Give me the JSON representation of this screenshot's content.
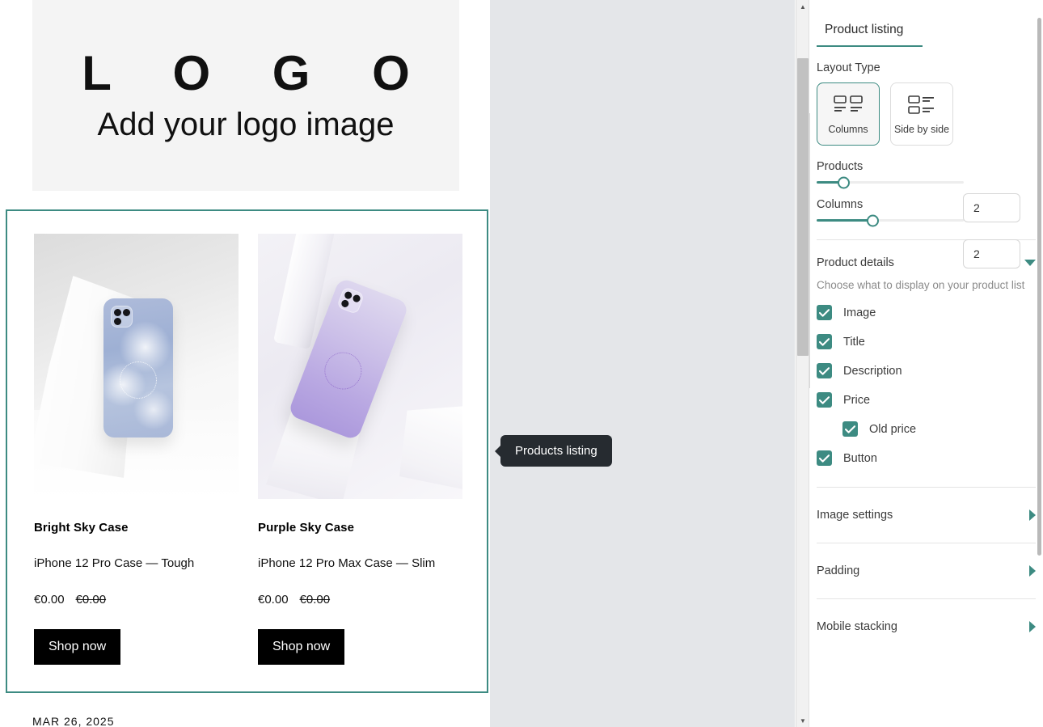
{
  "canvas": {
    "logo": {
      "word": "L O G O",
      "subtitle": "Add your logo image"
    },
    "selected_block_tooltip": "Products listing",
    "post_date": "MAR 26, 2025",
    "products": [
      {
        "title": "Bright Sky Case",
        "description": "iPhone 12 Pro Case — Tough",
        "price": "€0.00",
        "old_price": "€0.00",
        "button_label": "Shop now",
        "image_alt": "blue-cloud-phone-case"
      },
      {
        "title": "Purple Sky Case",
        "description": "iPhone 12 Pro Max Case — Slim",
        "price": "€0.00",
        "old_price": "€0.00",
        "button_label": "Shop now",
        "image_alt": "purple-gradient-phone-case"
      }
    ]
  },
  "panel": {
    "tab_label": "Product listing",
    "layout_type": {
      "label": "Layout Type",
      "options": [
        {
          "label": "Columns",
          "icon": "columns-layout-icon",
          "selected": true
        },
        {
          "label": "Side by side",
          "icon": "side-by-side-layout-icon",
          "selected": false
        }
      ]
    },
    "products_slider": {
      "label": "Products",
      "value": "2",
      "percent": 18
    },
    "columns_slider": {
      "label": "Columns",
      "value": "2",
      "percent": 38
    },
    "product_details": {
      "title": "Product details",
      "hint": "Choose what to display on your product list",
      "expanded": true,
      "items": [
        {
          "label": "Image",
          "checked": true,
          "indented": false
        },
        {
          "label": "Title",
          "checked": true,
          "indented": false
        },
        {
          "label": "Description",
          "checked": true,
          "indented": false
        },
        {
          "label": "Price",
          "checked": true,
          "indented": false
        },
        {
          "label": "Old price",
          "checked": true,
          "indented": true
        },
        {
          "label": "Button",
          "checked": true,
          "indented": false
        }
      ]
    },
    "sections": [
      {
        "title": "Image settings",
        "expanded": false
      },
      {
        "title": "Padding",
        "expanded": false
      },
      {
        "title": "Mobile stacking",
        "expanded": false
      }
    ]
  },
  "colors": {
    "accent": "#3d8b82",
    "canvas_bg": "#e4e6e9",
    "tooltip_bg": "#262b30",
    "button_bg": "#000000"
  }
}
